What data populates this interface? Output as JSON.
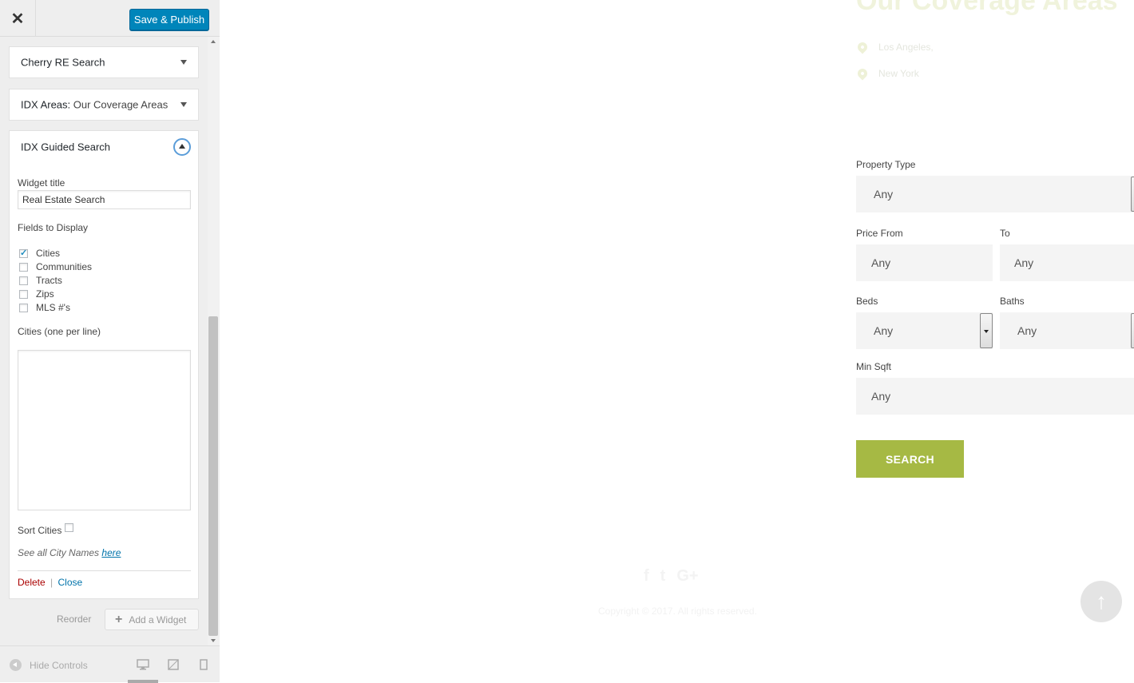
{
  "topbar": {
    "close_icon": "✕",
    "publish_label": "Save & Publish"
  },
  "widgets": [
    {
      "title": "Cherry RE Search",
      "subtitle": ""
    },
    {
      "title": "IDX Areas:",
      "subtitle": "Our Coverage Areas"
    },
    {
      "title": "IDX Guided Search",
      "subtitle": ""
    }
  ],
  "form": {
    "widget_title_label": "Widget title",
    "widget_title_value": "Real Estate Search",
    "fields_label": "Fields to Display",
    "fields": [
      {
        "label": "Cities",
        "checked": true
      },
      {
        "label": "Communities",
        "checked": false
      },
      {
        "label": "Tracts",
        "checked": false
      },
      {
        "label": "Zips",
        "checked": false
      },
      {
        "label": "MLS #'s",
        "checked": false
      }
    ],
    "cities_label": "Cities (one per line)",
    "cities_value": "",
    "sort_label": "Sort Cities",
    "note_prefix": "See all City Names",
    "note_link": "here",
    "delete_label": "Delete",
    "separator": "|",
    "close_label": "Close"
  },
  "widget_actions": {
    "reorder_label": "Reorder",
    "add_widget_label": "Add a Widget",
    "plus": "+"
  },
  "footer": {
    "hide_controls_label": "Hide Controls",
    "devices": [
      "desktop",
      "tablet",
      "mobile"
    ]
  },
  "preview": {
    "coverage_title": "Our Coverage Areas",
    "locations": [
      "Los Angeles,",
      "New York"
    ],
    "property_type_label": "Property Type",
    "property_type_value": "Any",
    "price_from_label": "Price From",
    "price_from_value": "Any",
    "to_label": "To",
    "to_value": "Any",
    "beds_label": "Beds",
    "beds_value": "Any",
    "baths_label": "Baths",
    "baths_value": "Any",
    "min_sqft_label": "Min Sqft",
    "min_sqft_value": "Any",
    "search_label": "SEARCH",
    "social": [
      "f",
      "t",
      "G+"
    ],
    "copyright": "Copyright © 2017. All rights reserved.",
    "accent_color": "#a6b944"
  }
}
